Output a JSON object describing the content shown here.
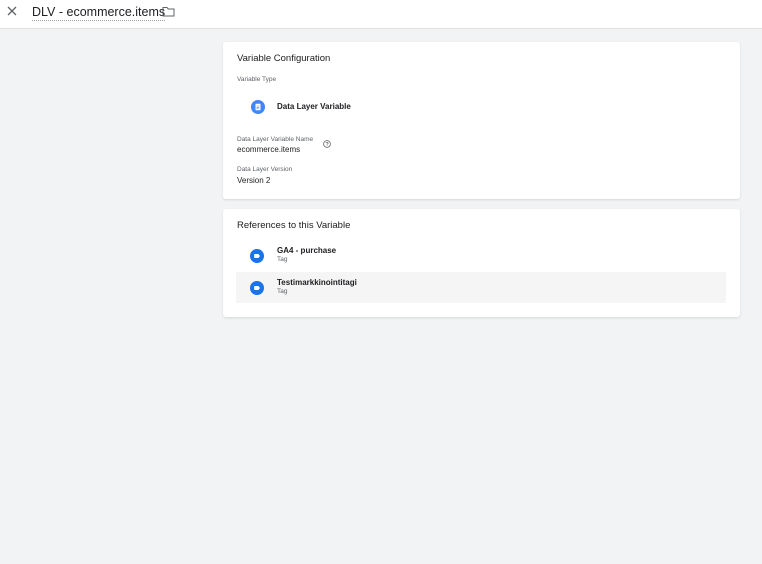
{
  "header": {
    "title": "DLV - ecommerce.items",
    "close_icon": "close-icon",
    "folder_icon": "folder-icon"
  },
  "config": {
    "title": "Variable Configuration",
    "type_label": "Variable Type",
    "type_name": "Data Layer Variable",
    "type_icon": "data-layer-variable-icon",
    "name_label": "Data Layer Variable Name",
    "name_value": "ecommerce.items",
    "version_label": "Data Layer Version",
    "version_value": "Version 2"
  },
  "references": {
    "title": "References to this Variable",
    "items": [
      {
        "name": "GA4 - purchase",
        "type": "Tag"
      },
      {
        "name": "Testimarkkinointitagi",
        "type": "Tag"
      }
    ]
  },
  "colors": {
    "accent_blue": "#1a73e8",
    "variable_icon_blue": "#4285f4",
    "background": "#f1f3f4"
  }
}
